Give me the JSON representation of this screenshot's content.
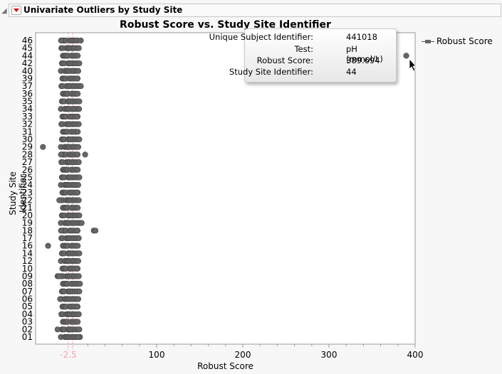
{
  "header": {
    "title": "Univariate Outliers by Study Site"
  },
  "tooltip": {
    "rows": [
      {
        "key": "Unique Subject Identifier:",
        "value": "441018"
      },
      {
        "key": "Test:",
        "value": "pH (mmol/L)"
      },
      {
        "key": "Robust Score:",
        "value": "389.694"
      },
      {
        "key": "Study Site Identifier:",
        "value": "44"
      }
    ]
  },
  "chart_data": {
    "type": "scatter",
    "title": "Robust Score vs. Study Site Identifier",
    "xlabel": "Robust Score",
    "ylabel": "Study Site Identifier",
    "xlim": [
      -41,
      400
    ],
    "xticks": [
      100,
      200,
      300,
      400
    ],
    "reference_lines": {
      "values": [
        -2.5,
        2.5
      ],
      "label": "-2.5",
      "color": "#f4a0b0"
    },
    "legend": {
      "entries": [
        "Robust Score"
      ],
      "placement": "right"
    },
    "categories": [
      "01",
      "02",
      "03",
      "04",
      "05",
      "06",
      "07",
      "08",
      "09",
      "10",
      "12",
      "14",
      "16",
      "17",
      "18",
      "19",
      "20",
      "21",
      "22",
      "23",
      "24",
      "25",
      "26",
      "27",
      "28",
      "29",
      "30",
      "31",
      "32",
      "33",
      "34",
      "35",
      "36",
      "37",
      "39",
      "40",
      "42",
      "44",
      "45",
      "46"
    ],
    "typical_values": [
      -10,
      -8,
      -6,
      -4,
      -2,
      0,
      1,
      3,
      5,
      7,
      9
    ],
    "extra_points": [
      {
        "site": "01",
        "x": [
          11,
          9
        ]
      },
      {
        "site": "02",
        "x": [
          -15
        ]
      },
      {
        "site": "06",
        "x": [
          -12
        ]
      },
      {
        "site": "08",
        "x": [
          11
        ]
      },
      {
        "site": "09",
        "x": [
          -15,
          -13
        ]
      },
      {
        "site": "16",
        "x": [
          -26
        ]
      },
      {
        "site": "18",
        "x": [
          27,
          29,
          -11
        ]
      },
      {
        "site": "19",
        "x": [
          11,
          13
        ]
      },
      {
        "site": "22",
        "x": [
          -13
        ]
      },
      {
        "site": "28",
        "x": [
          17,
          -11
        ]
      },
      {
        "site": "29",
        "x": [
          -32
        ]
      },
      {
        "site": "34",
        "x": [
          10
        ]
      },
      {
        "site": "37",
        "x": [
          12
        ]
      },
      {
        "site": "44",
        "x": [
          389.694
        ]
      },
      {
        "site": "46",
        "x": [
          12,
          -11
        ]
      }
    ]
  }
}
